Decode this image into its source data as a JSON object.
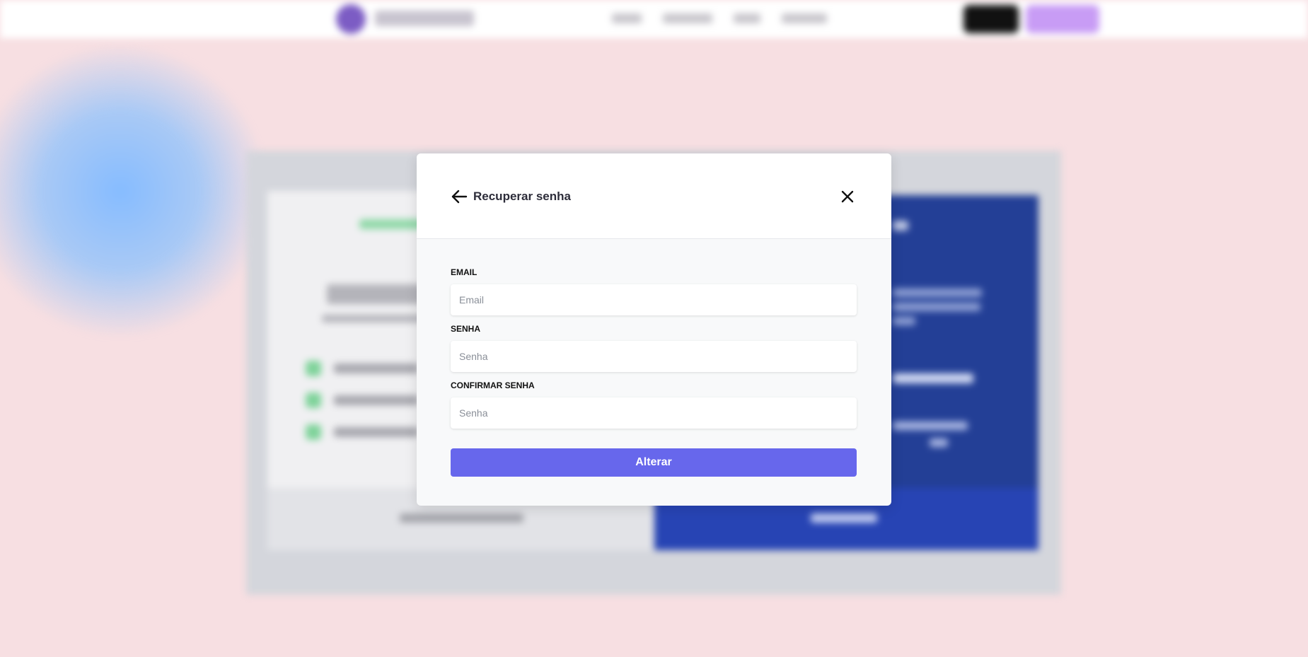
{
  "modal": {
    "title": "Recuperar senha",
    "back_icon": "arrow-left-icon",
    "close_icon": "close-icon",
    "fields": [
      {
        "label": "EMAIL",
        "placeholder": "Email"
      },
      {
        "label": "SENHA",
        "placeholder": "Senha"
      },
      {
        "label": "CONFIRMAR SENHA",
        "placeholder": "Senha"
      }
    ],
    "submit_label": "Alterar"
  },
  "colors": {
    "page_background": "#f7dfe2",
    "primary_button": "#6767ec",
    "overlay_panel_blue": "#233f96"
  }
}
